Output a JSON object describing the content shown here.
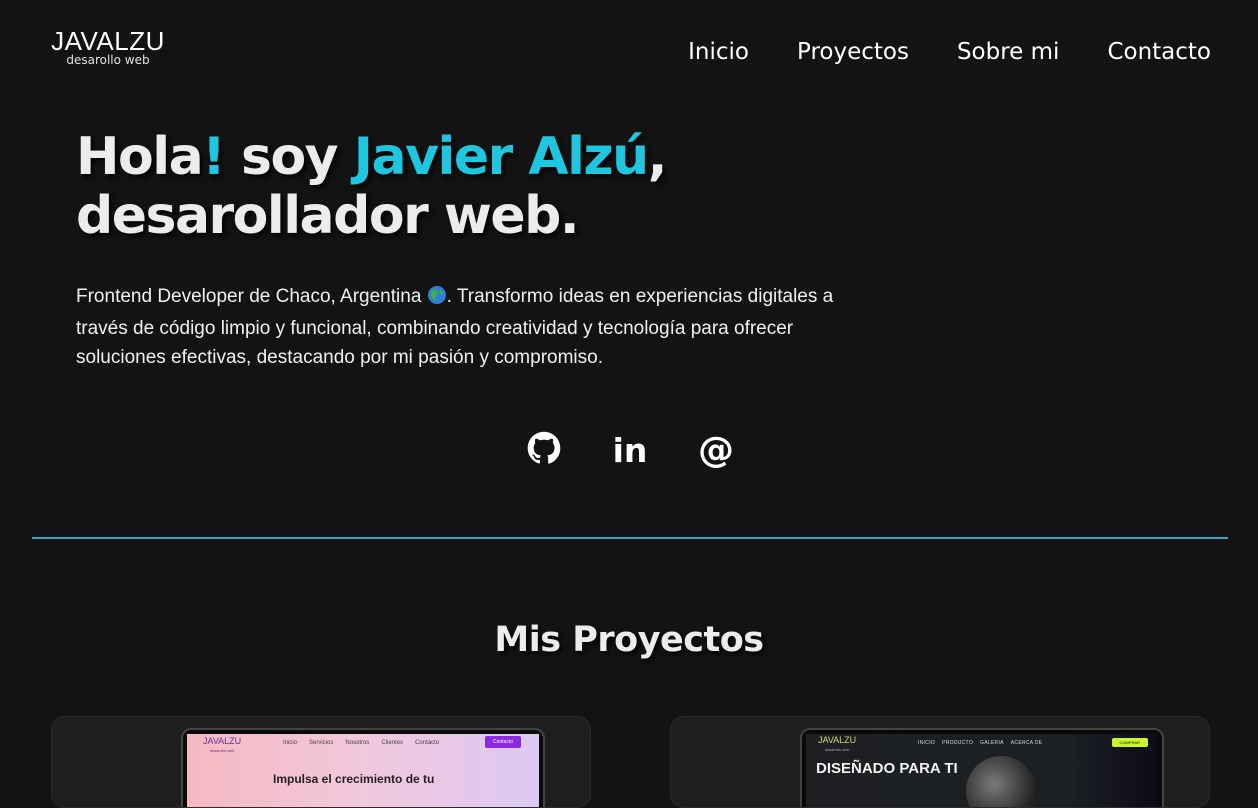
{
  "header": {
    "logo_main": "JAVALZU",
    "logo_sub": "desarollo web",
    "nav": [
      "Inicio",
      "Proyectos",
      "Sobre mi",
      "Contacto"
    ]
  },
  "hero": {
    "title_hola": "Hola",
    "title_excl": "!",
    "title_soy": " soy ",
    "title_name": "Javier Alzú",
    "title_comma": ",",
    "title_line2": "desarollador web.",
    "desc_before_globe": "Frontend Developer de Chaco, Argentina ",
    "desc_after_globe": ". Transformo ideas en experiencias digitales a través de código limpio y funcional, combinando creatividad y tecnología para ofrecer soluciones efectivas, destacando por mi pasión y compromiso.",
    "accent_color": "#1fc6df"
  },
  "socials": [
    {
      "icon": "github-icon"
    },
    {
      "icon": "linkedin-icon",
      "glyph": "in"
    },
    {
      "icon": "email-at-icon",
      "glyph": "@"
    }
  ],
  "projects": {
    "title": "Mis Proyectos",
    "card1": {
      "logo": "JAVALZU",
      "logo_sub": "desarollo web",
      "nav": [
        "Inicio",
        "Servicios",
        "Nosotros",
        "Clientes",
        "Contacto"
      ],
      "button": "Contacto",
      "headline": "Impulsa el crecimiento de tu"
    },
    "card2": {
      "logo": "JAVALZU",
      "logo_sub": "desarollo web",
      "nav": [
        "INICIO",
        "PRODUCTO",
        "GALERIA",
        "ACERCA DE"
      ],
      "button": "COMPRAR",
      "headline": "DISEÑADO PARA TI"
    }
  }
}
